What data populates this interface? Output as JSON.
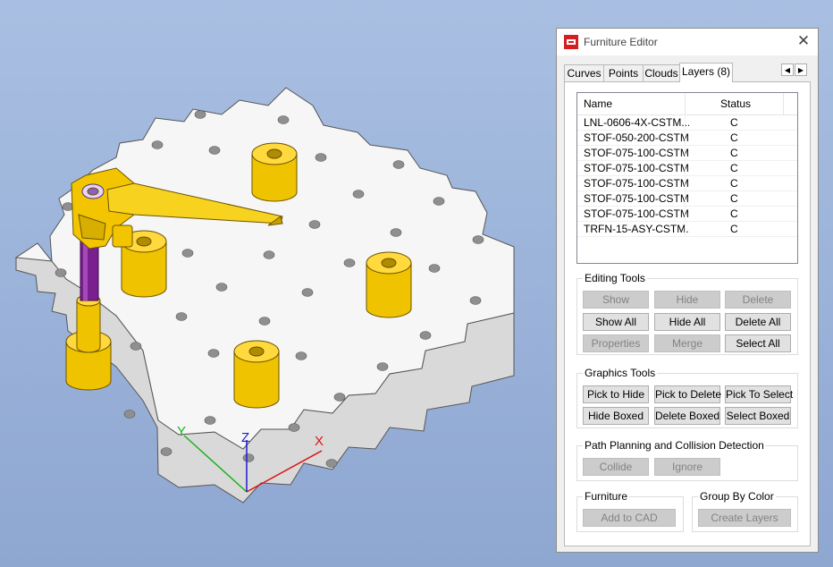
{
  "viewport": {
    "axis_labels": {
      "x": "X",
      "y": "Y",
      "z": "Z"
    },
    "colors": {
      "x_axis": "#e01010",
      "y_axis": "#19b31b",
      "z_axis": "#1c1ccf",
      "background": "#a9bfe2",
      "plate": "#f4f4f4",
      "fixture": "#f5c800",
      "post": "#7a1f8f"
    }
  },
  "window": {
    "title": "Furniture Editor",
    "icon": "furniture-editor-app-icon",
    "close_icon": "close-icon"
  },
  "tabs": [
    {
      "label": "Curves"
    },
    {
      "label": "Points"
    },
    {
      "label": "Clouds"
    },
    {
      "label": "Layers (8)",
      "active": true
    }
  ],
  "layers_list": {
    "columns": [
      "Name",
      "Status"
    ],
    "rows": [
      {
        "name": "LNL-0606-4X-CSTM...",
        "status": "C"
      },
      {
        "name": "STOF-050-200-CSTM...",
        "status": "C"
      },
      {
        "name": "STOF-075-100-CSTM...",
        "status": "C"
      },
      {
        "name": "STOF-075-100-CSTM...",
        "status": "C"
      },
      {
        "name": "STOF-075-100-CSTM...",
        "status": "C"
      },
      {
        "name": "STOF-075-100-CSTM...",
        "status": "C"
      },
      {
        "name": "STOF-075-100-CSTM...",
        "status": "C"
      },
      {
        "name": "TRFN-15-ASY-CSTM...",
        "status": "C"
      }
    ]
  },
  "editing_tools": {
    "label": "Editing Tools",
    "show": "Show",
    "hide": "Hide",
    "delete": "Delete",
    "show_all": "Show All",
    "hide_all": "Hide All",
    "delete_all": "Delete All",
    "properties": "Properties",
    "merge": "Merge",
    "select_all": "Select All"
  },
  "graphics_tools": {
    "label": "Graphics Tools",
    "pick_to_hide": "Pick to Hide",
    "pick_to_delete": "Pick to Delete",
    "pick_to_select": "Pick To Select",
    "hide_boxed": "Hide Boxed",
    "delete_boxed": "Delete Boxed",
    "select_boxed": "Select Boxed"
  },
  "path_planning": {
    "label": "Path Planning and Collision Detection",
    "collide": "Collide",
    "ignore": "Ignore"
  },
  "furniture": {
    "label": "Furniture",
    "add_to_cad": "Add to CAD"
  },
  "group_by_color": {
    "label": "Group By Color",
    "create_layers": "Create Layers"
  }
}
